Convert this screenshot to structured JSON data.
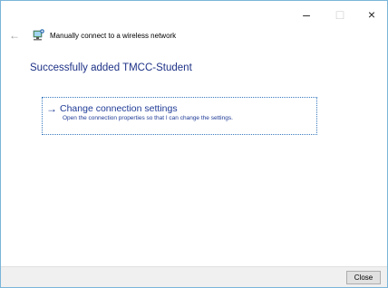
{
  "window": {
    "caption_buttons": {
      "minimize": "–",
      "maximize": "□",
      "close": "×"
    }
  },
  "header": {
    "back_icon": "←",
    "icon": "wireless-network-icon",
    "title": "Manually connect to a wireless network"
  },
  "main": {
    "instruction": "Successfully added TMCC-Student",
    "command_link": {
      "arrow": "→",
      "title": "Change connection settings",
      "description": "Open the connection properties so that I can change the settings."
    }
  },
  "footer": {
    "close_label": "Close"
  }
}
